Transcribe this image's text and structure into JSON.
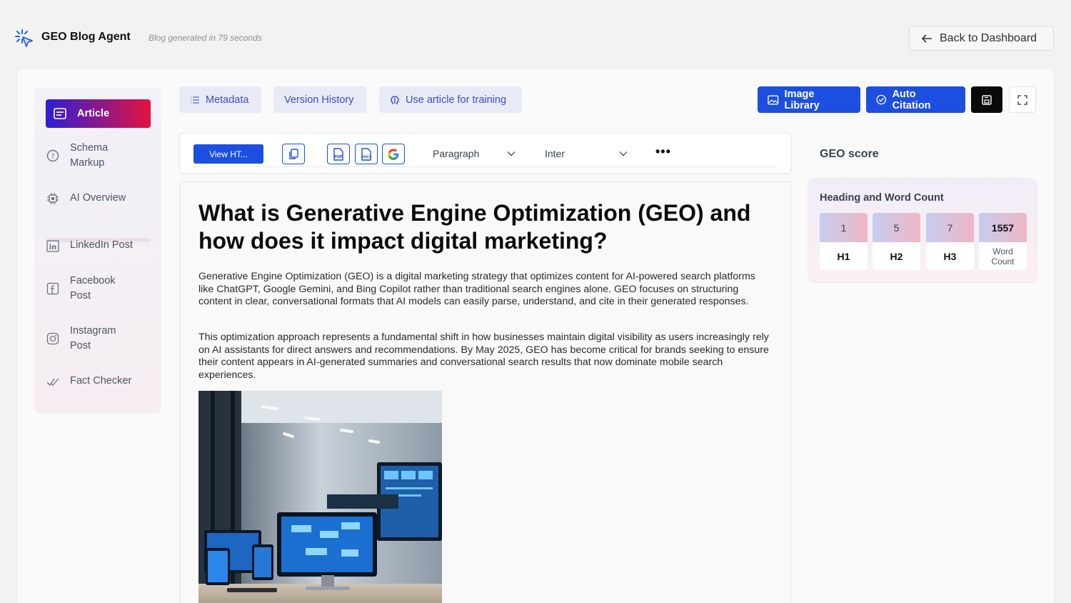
{
  "app": {
    "title": "GEO Blog Agent",
    "generation_note": "Blog generated in 79 seconds",
    "back_label": "Back to Dashboard"
  },
  "sidebar": {
    "items": [
      {
        "label": "Article",
        "icon": "article-icon",
        "active": true
      },
      {
        "label": "Schema Markup",
        "icon": "help-circle-icon",
        "active": false
      },
      {
        "label": "AI Overview",
        "icon": "chip-icon",
        "active": false
      },
      {
        "label": "LinkedIn Post",
        "icon": "linkedin-icon",
        "active": false
      },
      {
        "label": "Facebook Post",
        "icon": "facebook-icon",
        "active": false
      },
      {
        "label": "Instagram Post",
        "icon": "instagram-icon",
        "active": false
      },
      {
        "label": "Fact Checker",
        "icon": "check-icon",
        "active": false
      }
    ]
  },
  "tabs": {
    "metadata": "Metadata",
    "version_history": "Version History",
    "use_for_training": "Use article for training"
  },
  "actions": {
    "image_library": "Image Library",
    "auto_citation": "Auto Citation"
  },
  "toolbar": {
    "view_html": "View HT...",
    "block_type": "Paragraph",
    "font": "Inter"
  },
  "article": {
    "title": "What is Generative Engine Optimization (GEO) and how does it impact digital marketing?",
    "paragraphs": [
      "Generative Engine Optimization (GEO) is a digital marketing strategy that optimizes content for AI-powered search platforms like ChatGPT, Google Gemini, and Bing Copilot rather than traditional search engines alone. GEO focuses on structuring content in clear, conversational formats that AI models can easily parse, understand, and cite in their generated responses.",
      "This optimization approach represents a fundamental shift in how businesses maintain digital visibility as users increasingly rely on AI assistants for direct answers and recommendations. By May 2025, GEO has become critical for brands seeking to ensure their content appears in AI-generated summaries and conversational search results that now dominate mobile search experiences."
    ]
  },
  "geo": {
    "title": "GEO score",
    "heading_card_title": "Heading and Word Count",
    "stats": [
      {
        "value": "1",
        "label": "H1"
      },
      {
        "value": "5",
        "label": "H2"
      },
      {
        "value": "7",
        "label": "H3"
      },
      {
        "value": "1557",
        "label": "Word Count"
      }
    ]
  },
  "colors": {
    "primary": "#1c4fe0",
    "gradient_start": "#2c1fd6",
    "gradient_end": "#e4123f"
  }
}
